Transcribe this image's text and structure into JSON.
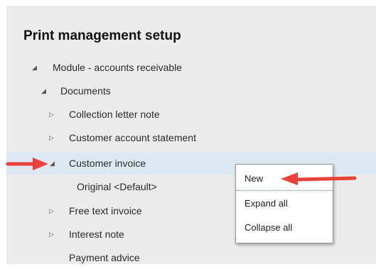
{
  "page": {
    "title": "Print management setup"
  },
  "tree": {
    "items": [
      {
        "label": "Module - accounts receivable",
        "expander": "expanded"
      },
      {
        "label": "Documents",
        "expander": "expanded"
      },
      {
        "label": "Collection letter note",
        "expander": "collapsed"
      },
      {
        "label": "Customer account statement",
        "expander": "collapsed"
      },
      {
        "label": "Customer invoice",
        "expander": "expanded",
        "selected": true
      },
      {
        "label": "Original <Default>",
        "expander": "none"
      },
      {
        "label": "Free text invoice",
        "expander": "collapsed"
      },
      {
        "label": "Interest note",
        "expander": "collapsed"
      },
      {
        "label": "Payment advice",
        "expander": "none"
      }
    ]
  },
  "context_menu": {
    "items": [
      {
        "label": "New"
      },
      {
        "label": "Expand all"
      },
      {
        "label": "Collapse all"
      }
    ]
  },
  "colors": {
    "panel_bg": "#ebebeb",
    "selected_row": "#dde8f3",
    "annotation_arrow": "#e8413a"
  },
  "icons": {
    "expanded": "triangle-down-right-icon",
    "collapsed": "triangle-right-outline-icon",
    "annotation": "red-arrow-icon"
  }
}
